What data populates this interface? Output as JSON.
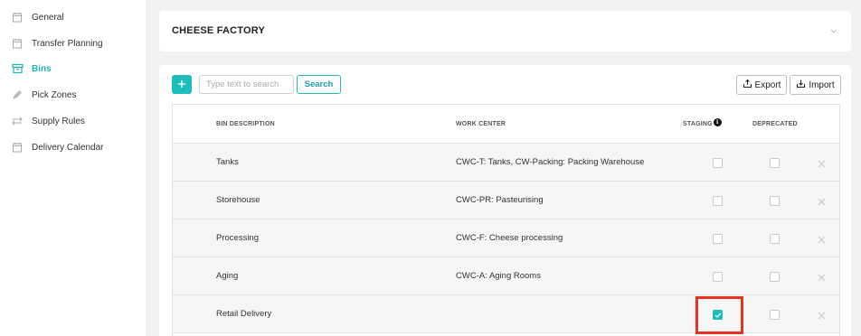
{
  "sidebar": {
    "items": [
      {
        "label": "General",
        "icon": "calendar-icon",
        "active": false
      },
      {
        "label": "Transfer Planning",
        "icon": "calendar-icon",
        "active": false
      },
      {
        "label": "Bins",
        "icon": "bin-icon",
        "active": true
      },
      {
        "label": "Pick Zones",
        "icon": "pencil-icon",
        "active": false
      },
      {
        "label": "Supply Rules",
        "icon": "arrows-icon",
        "active": false
      },
      {
        "label": "Delivery Calendar",
        "icon": "calendar-icon",
        "active": false
      }
    ]
  },
  "header": {
    "title": "CHEESE FACTORY"
  },
  "toolbar": {
    "search_placeholder": "Type text to search",
    "search_value": "",
    "search_label": "Search",
    "export_label": "Export",
    "import_label": "Import"
  },
  "table": {
    "columns": {
      "bin_description": "BIN DESCRIPTION",
      "work_center": "WORK CENTER",
      "staging": "STAGING",
      "deprecated": "DEPRECATED"
    },
    "info_glyph": "i",
    "rows": [
      {
        "bin_description": "Tanks",
        "work_center": "CWC-T: Tanks, CW-Packing: Packing Warehouse",
        "staging": false,
        "deprecated": false
      },
      {
        "bin_description": "Storehouse",
        "work_center": "CWC-PR: Pasteurising",
        "staging": false,
        "deprecated": false
      },
      {
        "bin_description": "Processing",
        "work_center": "CWC-F: Cheese processing",
        "staging": false,
        "deprecated": false
      },
      {
        "bin_description": "Aging",
        "work_center": "CWC-A: Aging Rooms",
        "staging": false,
        "deprecated": false
      },
      {
        "bin_description": "Retail Delivery",
        "work_center": "",
        "staging": true,
        "deprecated": false
      }
    ]
  },
  "colors": {
    "accent": "#1fbcbc",
    "active_nav": "#1fb6b6",
    "highlight": "#e8321f",
    "background": "#f2f2f2"
  }
}
